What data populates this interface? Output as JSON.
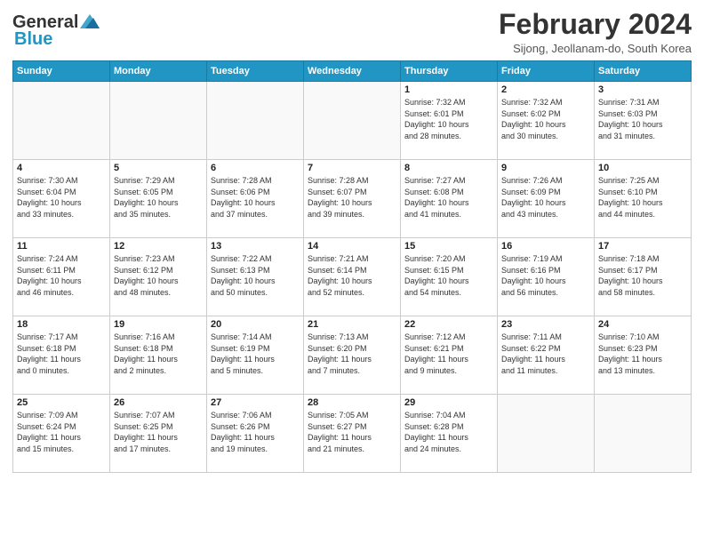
{
  "header": {
    "logo_line1": "General",
    "logo_line2": "Blue",
    "title": "February 2024",
    "subtitle": "Sijong, Jeollanam-do, South Korea"
  },
  "weekdays": [
    "Sunday",
    "Monday",
    "Tuesday",
    "Wednesday",
    "Thursday",
    "Friday",
    "Saturday"
  ],
  "weeks": [
    [
      {
        "day": "",
        "info": ""
      },
      {
        "day": "",
        "info": ""
      },
      {
        "day": "",
        "info": ""
      },
      {
        "day": "",
        "info": ""
      },
      {
        "day": "1",
        "info": "Sunrise: 7:32 AM\nSunset: 6:01 PM\nDaylight: 10 hours\nand 28 minutes."
      },
      {
        "day": "2",
        "info": "Sunrise: 7:32 AM\nSunset: 6:02 PM\nDaylight: 10 hours\nand 30 minutes."
      },
      {
        "day": "3",
        "info": "Sunrise: 7:31 AM\nSunset: 6:03 PM\nDaylight: 10 hours\nand 31 minutes."
      }
    ],
    [
      {
        "day": "4",
        "info": "Sunrise: 7:30 AM\nSunset: 6:04 PM\nDaylight: 10 hours\nand 33 minutes."
      },
      {
        "day": "5",
        "info": "Sunrise: 7:29 AM\nSunset: 6:05 PM\nDaylight: 10 hours\nand 35 minutes."
      },
      {
        "day": "6",
        "info": "Sunrise: 7:28 AM\nSunset: 6:06 PM\nDaylight: 10 hours\nand 37 minutes."
      },
      {
        "day": "7",
        "info": "Sunrise: 7:28 AM\nSunset: 6:07 PM\nDaylight: 10 hours\nand 39 minutes."
      },
      {
        "day": "8",
        "info": "Sunrise: 7:27 AM\nSunset: 6:08 PM\nDaylight: 10 hours\nand 41 minutes."
      },
      {
        "day": "9",
        "info": "Sunrise: 7:26 AM\nSunset: 6:09 PM\nDaylight: 10 hours\nand 43 minutes."
      },
      {
        "day": "10",
        "info": "Sunrise: 7:25 AM\nSunset: 6:10 PM\nDaylight: 10 hours\nand 44 minutes."
      }
    ],
    [
      {
        "day": "11",
        "info": "Sunrise: 7:24 AM\nSunset: 6:11 PM\nDaylight: 10 hours\nand 46 minutes."
      },
      {
        "day": "12",
        "info": "Sunrise: 7:23 AM\nSunset: 6:12 PM\nDaylight: 10 hours\nand 48 minutes."
      },
      {
        "day": "13",
        "info": "Sunrise: 7:22 AM\nSunset: 6:13 PM\nDaylight: 10 hours\nand 50 minutes."
      },
      {
        "day": "14",
        "info": "Sunrise: 7:21 AM\nSunset: 6:14 PM\nDaylight: 10 hours\nand 52 minutes."
      },
      {
        "day": "15",
        "info": "Sunrise: 7:20 AM\nSunset: 6:15 PM\nDaylight: 10 hours\nand 54 minutes."
      },
      {
        "day": "16",
        "info": "Sunrise: 7:19 AM\nSunset: 6:16 PM\nDaylight: 10 hours\nand 56 minutes."
      },
      {
        "day": "17",
        "info": "Sunrise: 7:18 AM\nSunset: 6:17 PM\nDaylight: 10 hours\nand 58 minutes."
      }
    ],
    [
      {
        "day": "18",
        "info": "Sunrise: 7:17 AM\nSunset: 6:18 PM\nDaylight: 11 hours\nand 0 minutes."
      },
      {
        "day": "19",
        "info": "Sunrise: 7:16 AM\nSunset: 6:18 PM\nDaylight: 11 hours\nand 2 minutes."
      },
      {
        "day": "20",
        "info": "Sunrise: 7:14 AM\nSunset: 6:19 PM\nDaylight: 11 hours\nand 5 minutes."
      },
      {
        "day": "21",
        "info": "Sunrise: 7:13 AM\nSunset: 6:20 PM\nDaylight: 11 hours\nand 7 minutes."
      },
      {
        "day": "22",
        "info": "Sunrise: 7:12 AM\nSunset: 6:21 PM\nDaylight: 11 hours\nand 9 minutes."
      },
      {
        "day": "23",
        "info": "Sunrise: 7:11 AM\nSunset: 6:22 PM\nDaylight: 11 hours\nand 11 minutes."
      },
      {
        "day": "24",
        "info": "Sunrise: 7:10 AM\nSunset: 6:23 PM\nDaylight: 11 hours\nand 13 minutes."
      }
    ],
    [
      {
        "day": "25",
        "info": "Sunrise: 7:09 AM\nSunset: 6:24 PM\nDaylight: 11 hours\nand 15 minutes."
      },
      {
        "day": "26",
        "info": "Sunrise: 7:07 AM\nSunset: 6:25 PM\nDaylight: 11 hours\nand 17 minutes."
      },
      {
        "day": "27",
        "info": "Sunrise: 7:06 AM\nSunset: 6:26 PM\nDaylight: 11 hours\nand 19 minutes."
      },
      {
        "day": "28",
        "info": "Sunrise: 7:05 AM\nSunset: 6:27 PM\nDaylight: 11 hours\nand 21 minutes."
      },
      {
        "day": "29",
        "info": "Sunrise: 7:04 AM\nSunset: 6:28 PM\nDaylight: 11 hours\nand 24 minutes."
      },
      {
        "day": "",
        "info": ""
      },
      {
        "day": "",
        "info": ""
      }
    ]
  ]
}
